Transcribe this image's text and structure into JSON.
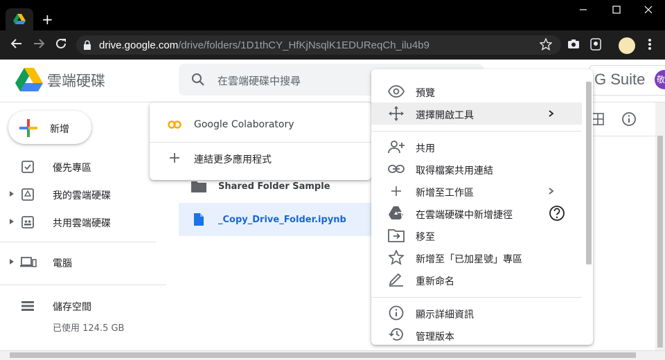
{
  "browser": {
    "new_tab": "+",
    "url_host": "drive.google.com",
    "url_path": "/drive/folders/1D1thCY_HfKjNsqlK1EDUReqCh_ilu4b9"
  },
  "drive": {
    "logo_text": "雲端硬碟",
    "search_placeholder": "在雲端硬碟中搜尋",
    "gsuite": "G Suite",
    "avatar_initial": "敬"
  },
  "sidebar": {
    "new_label": "新增",
    "items": [
      {
        "label": "優先專區"
      },
      {
        "label": "我的雲端硬碟"
      },
      {
        "label": "共用雲端硬碟"
      },
      {
        "label": "電腦"
      },
      {
        "label": "儲存空間"
      }
    ],
    "storage_used": "已使用 124.5 GB"
  },
  "files": [
    {
      "name": "Shared Folder Sample"
    },
    {
      "name": "_Copy_Drive_Folder.ipynb"
    }
  ],
  "open_with_menu": {
    "app": "Google Colaboratory",
    "connect_more": "連結更多應用程式"
  },
  "context_menu": {
    "preview": "預覽",
    "open_with": "選擇開啟工具",
    "share": "共用",
    "get_link": "取得檔案共用連結",
    "add_to_workspace": "新增至工作區",
    "add_shortcut": "在雲端硬碟中新增捷徑",
    "move_to": "移至",
    "add_starred": "新增至「已加星號」專區",
    "rename": "重新命名",
    "details": "顯示詳細資訊",
    "versions": "管理版本"
  },
  "colors": {
    "accent_blue": "#1a73e8",
    "selected_row": "#e8f0fe",
    "colab_orange": "#f9ab00"
  }
}
